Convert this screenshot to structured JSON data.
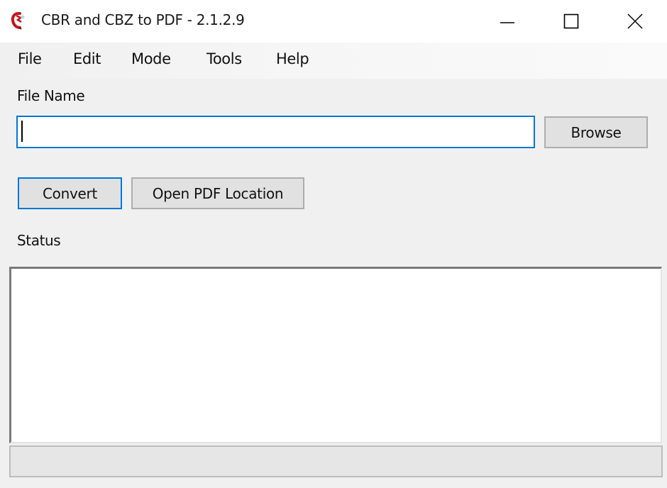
{
  "window": {
    "title": "CBR and CBZ to PDF - 2.1.2.9",
    "icon": "app-logo-icon",
    "controls": {
      "minimize_icon": "minimize-icon",
      "maximize_icon": "maximize-icon",
      "close_icon": "close-icon"
    }
  },
  "menu": {
    "items": [
      {
        "label": "File"
      },
      {
        "label": "Edit"
      },
      {
        "label": "Mode"
      },
      {
        "label": "Tools"
      },
      {
        "label": "Help"
      }
    ]
  },
  "form": {
    "file_name_label": "File Name",
    "file_name_value": "",
    "file_name_placeholder": "",
    "browse_label": "Browse",
    "convert_label": "Convert",
    "open_pdf_location_label": "Open PDF Location",
    "status_label": "Status",
    "status_text": ""
  },
  "progress": {
    "percent": 0
  },
  "colors": {
    "accent": "#0078d7",
    "icon_red": "#c4161c"
  }
}
